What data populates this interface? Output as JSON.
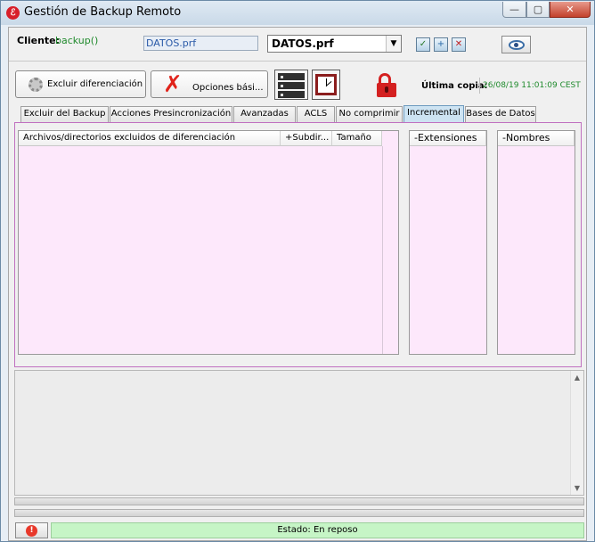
{
  "window": {
    "title": "Gestión de Backup Remoto",
    "app_icon": "backup-app-icon",
    "controls": {
      "minimize": "—",
      "maximize": "▢",
      "close": "✕"
    }
  },
  "client": {
    "label": "Cliente:",
    "value": "backup()",
    "prf_field": "DATOS.prf",
    "prf_select": "DATOS.prf",
    "select_arrow": "▼",
    "icons": [
      "check-icon",
      "new-file-icon",
      "delete-file-icon",
      "eye-icon"
    ]
  },
  "toolbar": {
    "exclude_diff_label": "Excluir diferenciación",
    "options_label": "Opciones bási...",
    "last_copy_label": "Última copia:",
    "last_copy_value": "26/08/19 11:01:09 CEST"
  },
  "tabs": [
    {
      "label": "Excluir del Backup",
      "active": false
    },
    {
      "label": "Acciones Presincronización",
      "active": false
    },
    {
      "label": "Avanzadas",
      "active": false
    },
    {
      "label": "ACLS",
      "active": false
    },
    {
      "label": "No comprimir",
      "active": false
    },
    {
      "label": "Incremental",
      "active": true
    },
    {
      "label": "Bases de Datos",
      "active": false
    }
  ],
  "lists": {
    "main_columns": [
      "Archivos/directorios excluidos de diferenciación",
      "+Subdir...",
      "Tamaño"
    ],
    "extensions_header": "-Extensiones",
    "names_header": "-Nombres"
  },
  "status": {
    "text": "Estado: En reposo",
    "alert_glyph": "!"
  },
  "colors": {
    "list_bg": "#fde8fb",
    "status_bg": "#c6f5c6",
    "client_value": "#1f8a2c",
    "close_button": "#c3412c"
  }
}
